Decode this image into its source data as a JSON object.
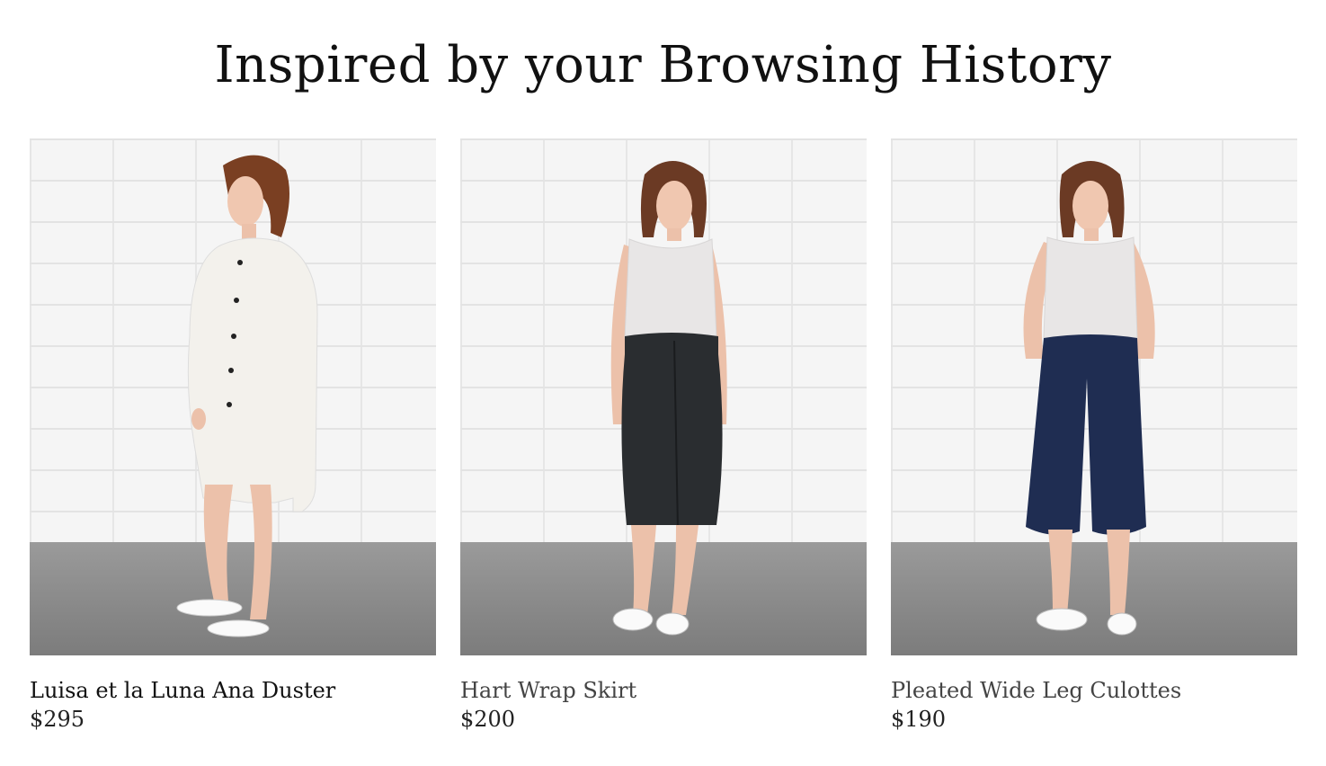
{
  "section": {
    "title": "Inspired by your Browsing History"
  },
  "products": [
    {
      "name": "Luisa et la Luna Ana Duster",
      "price": "$295"
    },
    {
      "name": "Hart Wrap Skirt",
      "price": "$200"
    },
    {
      "name": "Pleated Wide Leg Culottes",
      "price": "$190"
    }
  ],
  "colors": {
    "text": "#111111",
    "skirt": "#2a2d30",
    "culottes": "#1f2d52",
    "top": "#e8e6e6",
    "duster": "#f1efea"
  }
}
